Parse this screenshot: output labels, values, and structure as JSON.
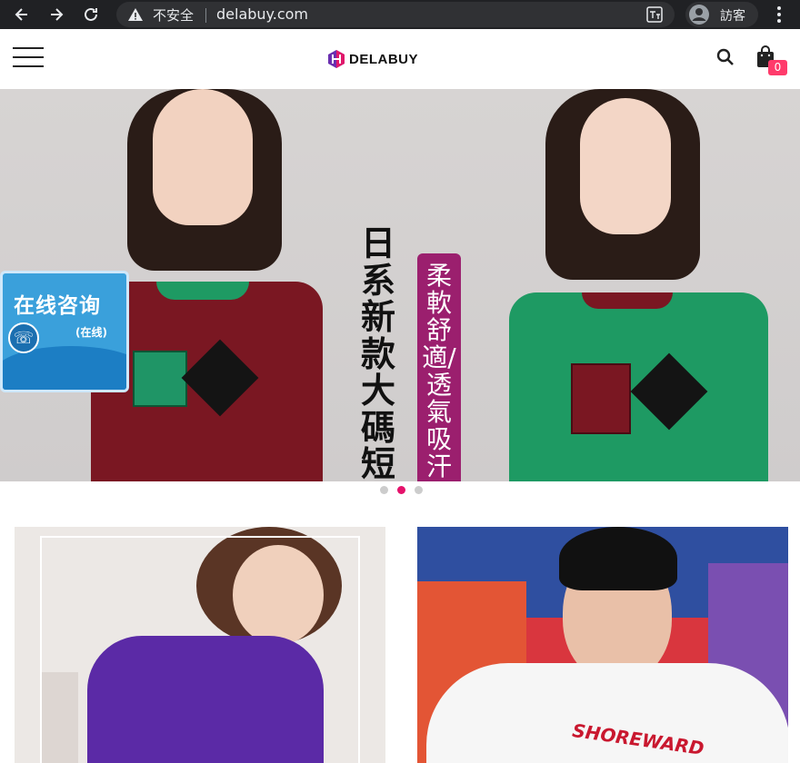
{
  "browser": {
    "insecure_label": "不安全",
    "url": "delabuy.com",
    "profile_label": "訪客"
  },
  "header": {
    "logo_text": "DELABUY",
    "cart_count": "0"
  },
  "banner": {
    "title_vertical": "日系新款大碼短袖",
    "pill_vertical": "柔軟舒適/透氣吸汗",
    "consult_title": "在线咨询",
    "consult_sub": "(在线)"
  },
  "carousel": {
    "slide_count": 3,
    "active_index": 1
  },
  "products": {
    "right_print": "SHOREWARD"
  },
  "colors": {
    "accent_pink": "#e5126b",
    "badge_pink": "#ff3b6b",
    "pill_purple": "#9b1f6e"
  }
}
